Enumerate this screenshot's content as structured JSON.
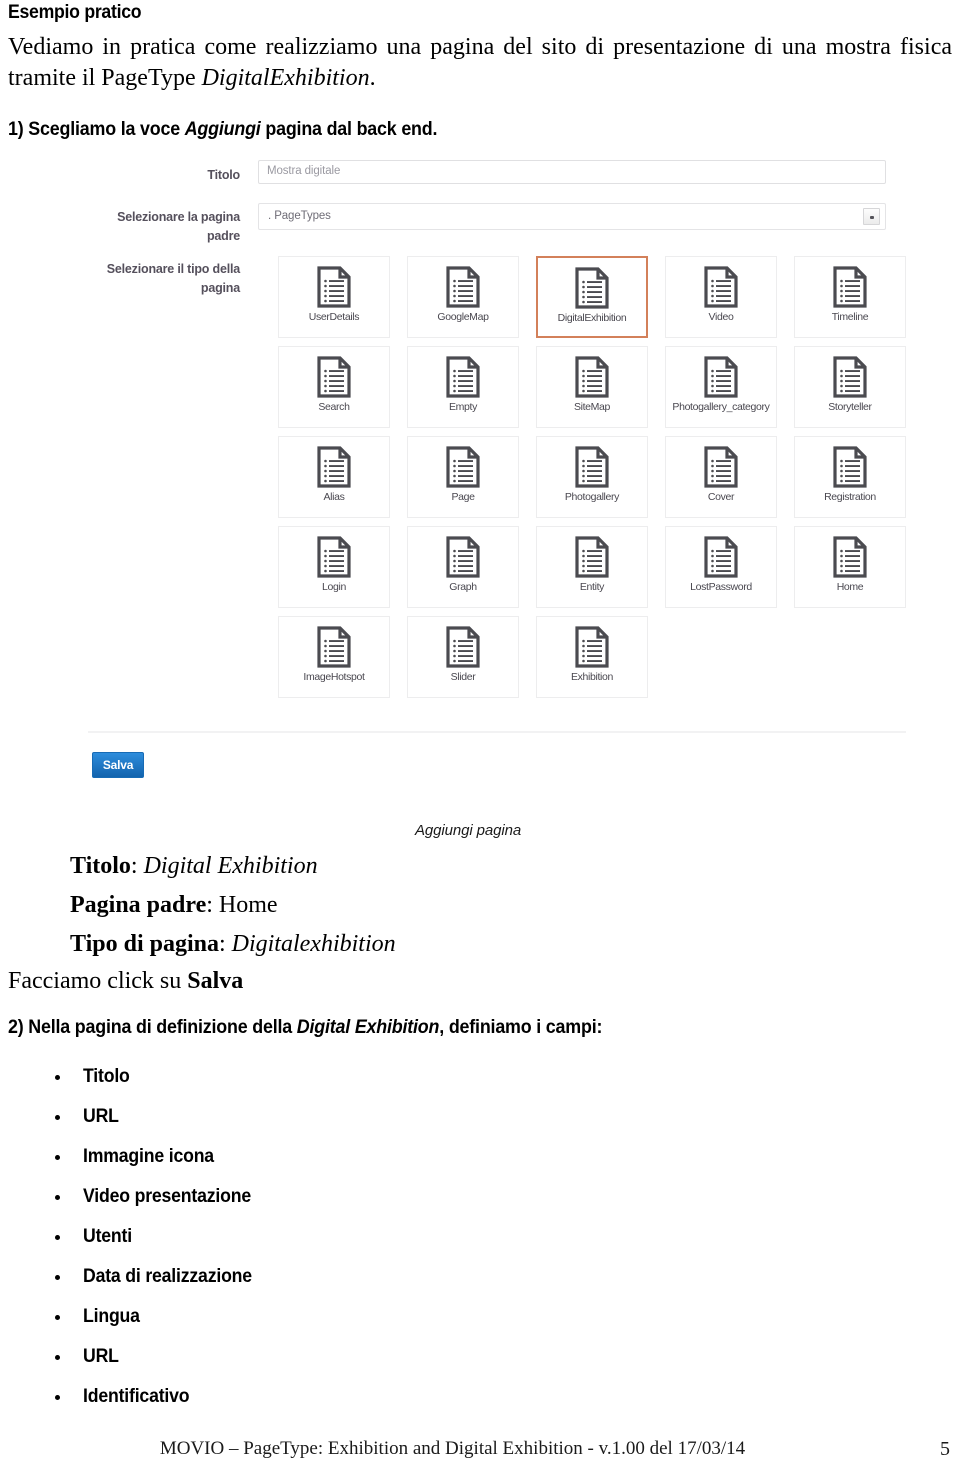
{
  "document": {
    "heading": "Esempio pratico",
    "intro_before": "Vediamo in pratica come realizziamo una pagina del sito di presentazione di una mostra fisica tramite il PageType ",
    "intro_italic": "DigitalExhibition",
    "intro_after": ".",
    "step1_before": "1) Scegliamo la voce ",
    "step1_italic": "Aggiungi",
    "step1_after": " pagina dal back end.",
    "step2_before": "2) Nella pagina di definizione della ",
    "step2_italic": "Digital Exhibition",
    "step2_after": ", definiamo i campi:"
  },
  "screenshot": {
    "caption": "Aggiungi pagina",
    "fields": {
      "title_label": "Titolo",
      "title_value": "Mostra digitale",
      "parent_label": "Selezionare la pagina padre",
      "parent_value": ". PageTypes",
      "type_label": "Selezionare il tipo della pagina"
    },
    "save_label": "Salva",
    "selected_page_type": "DigitalExhibition",
    "selected_border_color": "#d3805a",
    "save_button_color": "#1c79c8",
    "page_types": [
      {
        "label": "UserDetails",
        "icon": "document-icon",
        "selected": false
      },
      {
        "label": "GoogleMap",
        "icon": "document-icon",
        "selected": false
      },
      {
        "label": "DigitalExhibition",
        "icon": "document-icon",
        "selected": true
      },
      {
        "label": "Video",
        "icon": "document-icon",
        "selected": false
      },
      {
        "label": "Timeline",
        "icon": "document-icon",
        "selected": false
      },
      {
        "label": "Search",
        "icon": "document-icon",
        "selected": false
      },
      {
        "label": "Empty",
        "icon": "document-icon",
        "selected": false
      },
      {
        "label": "SiteMap",
        "icon": "document-icon",
        "selected": false
      },
      {
        "label": "Photogallery_category",
        "icon": "document-icon",
        "selected": false
      },
      {
        "label": "Storyteller",
        "icon": "document-icon",
        "selected": false
      },
      {
        "label": "Alias",
        "icon": "document-icon",
        "selected": false
      },
      {
        "label": "Page",
        "icon": "document-icon",
        "selected": false
      },
      {
        "label": "Photogallery",
        "icon": "document-icon",
        "selected": false
      },
      {
        "label": "Cover",
        "icon": "document-icon",
        "selected": false
      },
      {
        "label": "Registration",
        "icon": "document-icon",
        "selected": false
      },
      {
        "label": "Login",
        "icon": "document-icon",
        "selected": false
      },
      {
        "label": "Graph",
        "icon": "document-icon",
        "selected": false
      },
      {
        "label": "Entity",
        "icon": "document-icon",
        "selected": false
      },
      {
        "label": "LostPassword",
        "icon": "document-icon",
        "selected": false
      },
      {
        "label": "Home",
        "icon": "document-icon",
        "selected": false
      },
      {
        "label": "ImageHotspot",
        "icon": "document-icon",
        "selected": false
      },
      {
        "label": "Slider",
        "icon": "document-icon",
        "selected": false
      },
      {
        "label": "Exhibition",
        "icon": "document-icon",
        "selected": false
      }
    ]
  },
  "summary": {
    "line1_key": "Titolo",
    "line1_sep": ": ",
    "line1_value": "Digital Exhibition",
    "line2_key": "Pagina padre",
    "line2_sep": ": ",
    "line2_value": "Home",
    "line3_key": "Tipo di pagina",
    "line3_sep": ": ",
    "line3_value_a": "Digital",
    "line3_value_b": "exhibition",
    "click_before": "Facciamo click su ",
    "click_bold": "Salva"
  },
  "field_list": [
    "Titolo",
    "URL",
    "Immagine icona",
    "Video presentazione",
    "Utenti",
    "Data di realizzazione",
    "Lingua",
    "URL",
    "Identificativo"
  ],
  "footer": {
    "text": "MOVIO – PageType: Exhibition and Digital Exhibition - v.1.00 del 17/03/14",
    "page_number": "5"
  }
}
